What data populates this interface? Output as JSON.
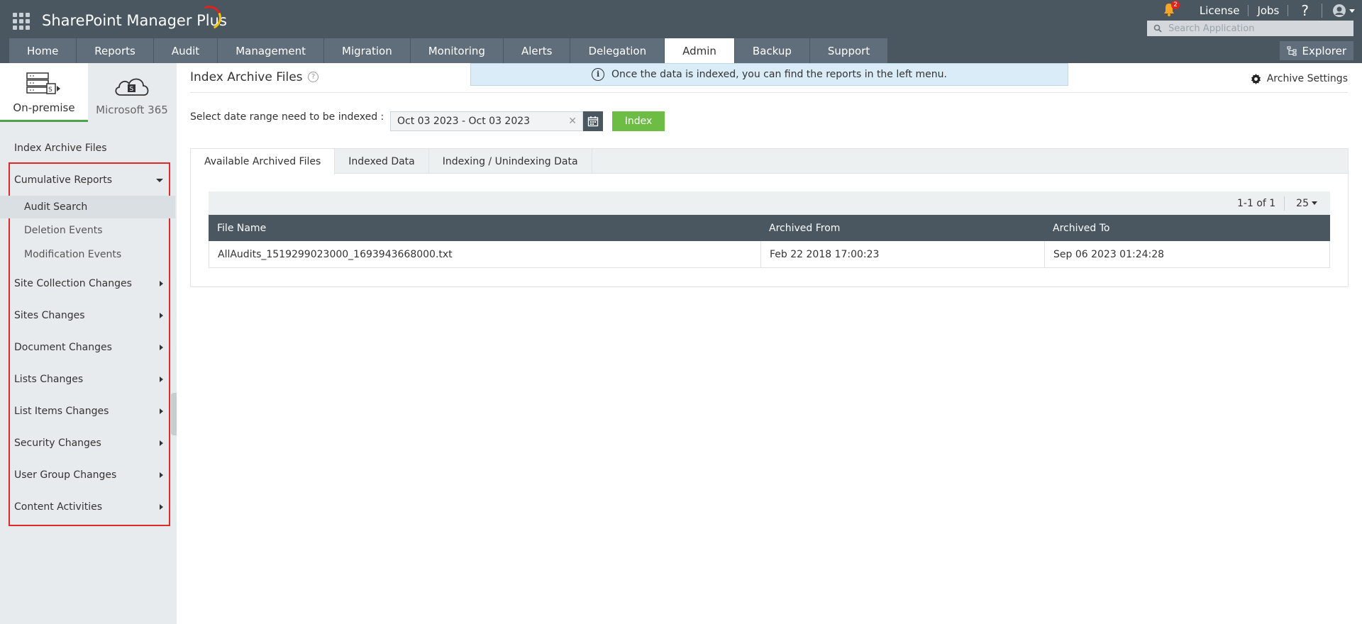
{
  "app": {
    "title": "SharePoint Manager Plus"
  },
  "top_links": {
    "notifications_count": "2",
    "license": "License",
    "jobs": "Jobs",
    "help": "?"
  },
  "search": {
    "placeholder": "Search Application"
  },
  "nav": {
    "tabs": [
      "Home",
      "Reports",
      "Audit",
      "Management",
      "Migration",
      "Monitoring",
      "Alerts",
      "Delegation",
      "Admin",
      "Backup",
      "Support"
    ],
    "active": "Admin",
    "explorer": "Explorer"
  },
  "sidebar": {
    "modes": [
      {
        "label": "On-premise",
        "icon": "server-icon",
        "active": true
      },
      {
        "label": "Microsoft 365",
        "icon": "cloud-sharepoint-icon",
        "active": false
      }
    ],
    "index_archive": "Index Archive Files",
    "cumulative_reports": {
      "label": "Cumulative Reports",
      "items": [
        "Audit Search",
        "Deletion Events",
        "Modification Events"
      ],
      "selected": "Audit Search"
    },
    "menus": [
      "Site Collection Changes",
      "Sites Changes",
      "Document Changes",
      "Lists Changes",
      "List Items Changes",
      "Security Changes",
      "User Group Changes",
      "Content Activities"
    ]
  },
  "main": {
    "title": "Index Archive Files",
    "info_banner": "Once the data is indexed, you can find the reports in the left menu.",
    "archive_settings": "Archive Settings",
    "date_label": "Select date range need to be indexed :",
    "date_value": "Oct 03 2023 - Oct 03 2023",
    "index_button": "Index",
    "tabs": [
      "Available Archived Files",
      "Indexed Data",
      "Indexing / Unindexing Data"
    ],
    "active_tab": "Available Archived Files",
    "pager": {
      "range": "1-1 of 1",
      "page_size": "25"
    },
    "table": {
      "columns": [
        "File Name",
        "Archived From",
        "Archived To"
      ],
      "rows": [
        [
          "AllAudits_1519299023000_1693943668000.txt",
          "Feb 22 2018 17:00:23",
          "Sep 06 2023 01:24:28"
        ]
      ]
    }
  },
  "colors": {
    "header_bg": "#4a5660",
    "tab_bg": "#5f6e7a",
    "accent_green": "#6dbd45",
    "highlight_red": "#e02a2a",
    "banner_bg": "#d9ecf7"
  }
}
